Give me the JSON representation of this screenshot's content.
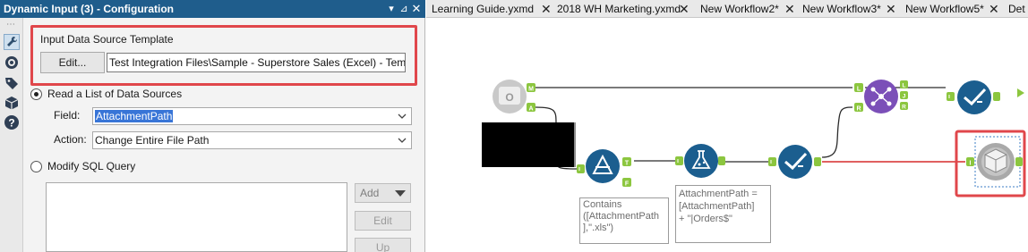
{
  "config_panel": {
    "title": "Dynamic Input (3) - Configuration",
    "title_buttons": {
      "dropdown": "▾",
      "pin": "⊿",
      "close": "✕"
    },
    "template_group_label": "Input Data Source Template",
    "edit_button": "Edit...",
    "template_path": "Test Integration Files\\Sample - Superstore Sales (Excel) - Template.xls",
    "radio_list_label": "Read a List of Data Sources",
    "radio_list_checked": true,
    "field_label": "Field:",
    "field_value": "AttachmentPath",
    "action_label": "Action:",
    "action_value": "Change Entire File Path",
    "radio_sql_label": "Modify SQL Query",
    "radio_sql_checked": false,
    "add_button": "Add",
    "edit2_button": "Edit",
    "up_button": "Up",
    "side_icons": [
      "wrench-icon",
      "target-icon",
      "tag-icon",
      "box-icon",
      "help-icon"
    ],
    "accent_color": "#1f5d8c",
    "highlight_color": "#e0474b"
  },
  "tabs": [
    {
      "label": "Learning Guide.yxmd"
    },
    {
      "label": "2018 WH Marketing.yxmd"
    },
    {
      "label": "New Workflow2*"
    },
    {
      "label": "New Workflow3*"
    },
    {
      "label": "New Workflow5*"
    },
    {
      "label": "Det"
    }
  ],
  "workflow": {
    "filter_annotation": "Contains\n([AttachmentPath\n],\".xls\")",
    "formula_annotation": "AttachmentPath =\n[AttachmentPath]\n+ \"|Orders$\"",
    "anchors": {
      "input_m": "M",
      "input_a": "A",
      "join_l": "L",
      "join_r": "R",
      "join_out_l": "L",
      "join_out_j": "J",
      "join_out_r": "R",
      "filter_t": "T",
      "filter_f": "F",
      "dyn_in": "I"
    },
    "colors": {
      "tool_blue": "#1b5e8f",
      "anchor_green": "#8cc63f",
      "join_purple": "#7b4fb8",
      "red_line": "#d62b2b"
    }
  }
}
